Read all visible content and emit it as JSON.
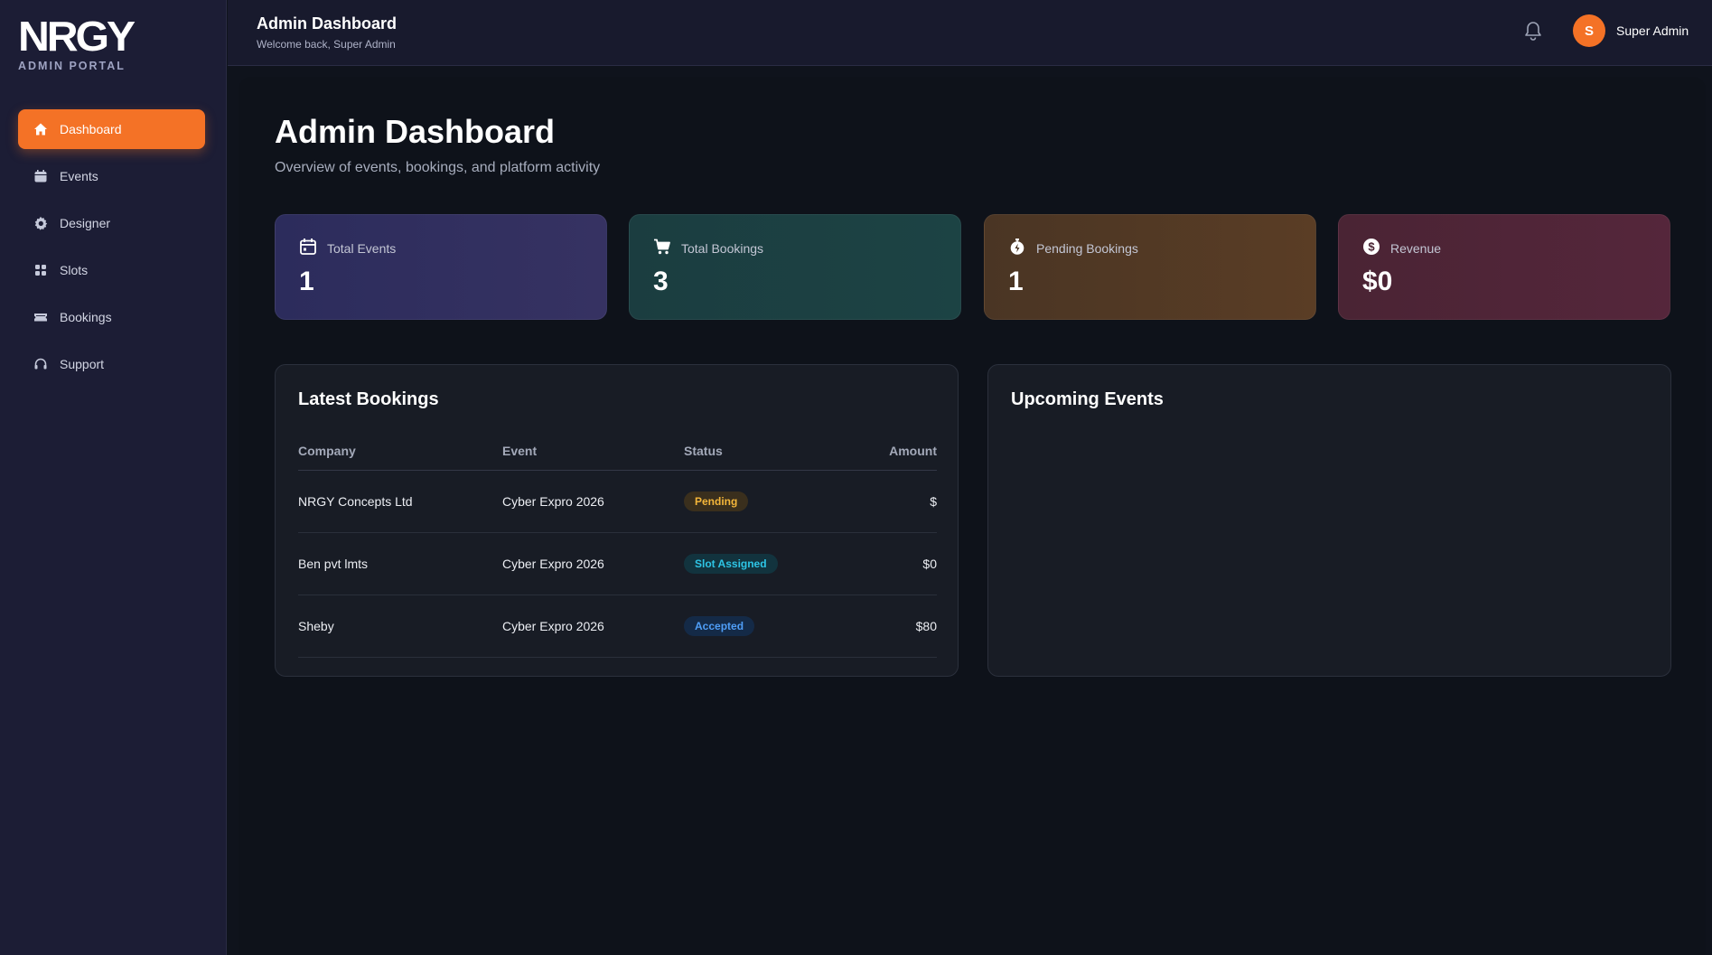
{
  "brand": {
    "logo": "NRGY",
    "subtitle": "ADMIN PORTAL"
  },
  "sidebar": {
    "items": [
      {
        "label": "Dashboard",
        "icon": "home-icon",
        "active": true
      },
      {
        "label": "Events",
        "icon": "calendar-icon",
        "active": false
      },
      {
        "label": "Designer",
        "icon": "gear-icon",
        "active": false
      },
      {
        "label": "Slots",
        "icon": "grid-icon",
        "active": false
      },
      {
        "label": "Bookings",
        "icon": "ticket-icon",
        "active": false
      },
      {
        "label": "Support",
        "icon": "headset-icon",
        "active": false
      }
    ]
  },
  "topbar": {
    "title": "Admin Dashboard",
    "subtitle": "Welcome back, Super Admin",
    "avatar_initial": "S",
    "user_name": "Super Admin"
  },
  "page": {
    "title": "Admin Dashboard",
    "subtitle": "Overview of events, bookings, and platform activity"
  },
  "stats": [
    {
      "label": "Total Events",
      "value": "1",
      "icon": "calendar-icon"
    },
    {
      "label": "Total Bookings",
      "value": "3",
      "icon": "cart-icon"
    },
    {
      "label": "Pending Bookings",
      "value": "1",
      "icon": "stopwatch-icon"
    },
    {
      "label": "Revenue",
      "value": "$0",
      "icon": "dollar-icon"
    }
  ],
  "latest_bookings": {
    "title": "Latest Bookings",
    "columns": [
      "Company",
      "Event",
      "Status",
      "Amount"
    ],
    "rows": [
      {
        "company": "NRGY Concepts Ltd",
        "event": "Cyber Expro 2026",
        "status": "Pending",
        "amount": "$"
      },
      {
        "company": "Ben pvt lmts",
        "event": "Cyber Expro 2026",
        "status": "Slot Assigned",
        "amount": "$0"
      },
      {
        "company": "Sheby",
        "event": "Cyber Expro 2026",
        "status": "Accepted",
        "amount": "$80"
      }
    ]
  },
  "upcoming_events": {
    "title": "Upcoming Events"
  },
  "colors": {
    "accent": "#f47226",
    "sidebar_bg": "#1c1d35",
    "status_pending": "#f4b63a",
    "status_slot_assigned": "#2ec5e6",
    "status_accepted": "#4f9ef7"
  }
}
